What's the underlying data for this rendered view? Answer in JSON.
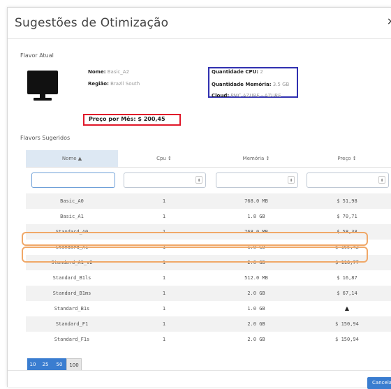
{
  "dialog": {
    "title": "Sugestões de Otimização",
    "close_label": "×"
  },
  "current_flavor": {
    "section_label": "Flavor Atual",
    "icon": "monitor-icon",
    "name_label": "Nome:",
    "name_value": "Basic_A2",
    "region_label": "Região:",
    "region_value": "Brazil South",
    "cpu_label": "Quantidade CPU:",
    "cpu_value": "2",
    "memory_label": "Quantidade Memória:",
    "memory_value": "3.5 GB",
    "cloud_label": "Cloud:",
    "cloud_value": "PMC AZURE - AZURE",
    "price_text": "Preço por Mês: $ 200,45"
  },
  "suggested": {
    "section_label": "Flavors Sugeridos",
    "columns": [
      "Nome ▲",
      "Cpu ↕",
      "Memória ↕",
      "Preço ↕"
    ],
    "rows": [
      {
        "name": "Basic_A0",
        "cpu": "1",
        "memory": "768.0 MB",
        "price": "$ 51,98"
      },
      {
        "name": "Basic_A1",
        "cpu": "1",
        "memory": "1.8 GB",
        "price": "$ 70,71"
      },
      {
        "name": "Standard_A0",
        "cpu": "1",
        "memory": "768.0 MB",
        "price": "$ 58,38"
      },
      {
        "name": "Standard_A1",
        "cpu": "1",
        "memory": "1.8 GB",
        "price": "$ 165,42"
      },
      {
        "name": "Standard_A1_v2",
        "cpu": "1",
        "memory": "2.0 GB",
        "price": "$ 116,77"
      },
      {
        "name": "Standard_B1ls",
        "cpu": "1",
        "memory": "512.0 MB",
        "price": "$ 16,87"
      },
      {
        "name": "Standard_B1ms",
        "cpu": "1",
        "memory": "2.0 GB",
        "price": "$ 67,14"
      },
      {
        "name": "Standard_B1s",
        "cpu": "1",
        "memory": "1.0 GB",
        "price": "▲"
      },
      {
        "name": "Standard_F1",
        "cpu": "1",
        "memory": "2.0 GB",
        "price": "$ 150,94"
      },
      {
        "name": "Standard_F1s",
        "cpu": "1",
        "memory": "2.0 GB",
        "price": "$ 150,94"
      }
    ]
  },
  "pagination": {
    "sizes": [
      "10",
      "25",
      "50",
      "100"
    ],
    "active": "100"
  },
  "footer": {
    "cancel_label": "Cancelar"
  },
  "colors": {
    "primary": "#3a7dd0",
    "highlight_red": "#e0182a",
    "highlight_blue": "#3030b0",
    "highlight_orange": "#f0a868"
  }
}
